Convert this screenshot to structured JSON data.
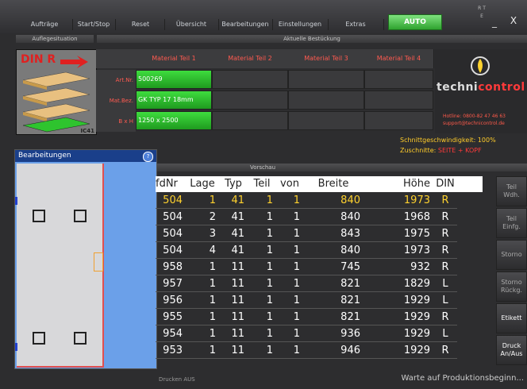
{
  "menu": {
    "items": [
      "Aufträge",
      "Start/Stop",
      "Reset",
      "Übersicht",
      "Bearbeitungen",
      "Einstellungen",
      "Extras"
    ],
    "auto_label": "AUTO",
    "rte_label": "R T E",
    "minimize_label": "_",
    "close_label": "X"
  },
  "headers": {
    "aufl": "Auflegesituation",
    "bestueckung": "Aktuelle Bestückung",
    "vorschau": "Vorschau"
  },
  "aufl": {
    "din_label": "DIN R",
    "ic_label": "IC41"
  },
  "material": {
    "columns": [
      "Material Teil 1",
      "Material Teil 2",
      "Material Teil 3",
      "Material Teil 4"
    ],
    "row_labels": [
      "Art.Nr.",
      "Mat.Bez.",
      "B x H"
    ],
    "teil1": [
      "500269",
      "GK TYP 17 18mm",
      "1250 x 2500"
    ]
  },
  "logo": {
    "text_a": "techni",
    "text_b": "control",
    "hotline_1": "Hotline: 0800-82 47 46 63",
    "hotline_2": "support@technicontrol.de"
  },
  "info": {
    "cut_speed": "Schnittgeschwindigkeit: 100%",
    "cuts_label": "Zuschnitte:",
    "cuts_value": "SEITE + KOPF"
  },
  "bearb": {
    "title": "Bearbeitungen",
    "help": "?"
  },
  "table": {
    "headers": [
      "fdNr",
      "Lage",
      "Typ",
      "Teil",
      "von",
      "Breite",
      "Höhe",
      "DIN"
    ],
    "rows": [
      [
        "504",
        "1",
        "41",
        "1",
        "1",
        "840",
        "1973",
        "R"
      ],
      [
        "504",
        "2",
        "41",
        "1",
        "1",
        "840",
        "1968",
        "R"
      ],
      [
        "504",
        "3",
        "41",
        "1",
        "1",
        "843",
        "1975",
        "R"
      ],
      [
        "504",
        "4",
        "41",
        "1",
        "1",
        "840",
        "1973",
        "R"
      ],
      [
        "958",
        "1",
        "11",
        "1",
        "1",
        "745",
        "932",
        "R"
      ],
      [
        "957",
        "1",
        "11",
        "1",
        "1",
        "821",
        "1829",
        "L"
      ],
      [
        "956",
        "1",
        "11",
        "1",
        "1",
        "821",
        "1929",
        "L"
      ],
      [
        "955",
        "1",
        "11",
        "1",
        "1",
        "821",
        "1929",
        "R"
      ],
      [
        "954",
        "1",
        "11",
        "1",
        "1",
        "936",
        "1929",
        "L"
      ],
      [
        "953",
        "1",
        "11",
        "1",
        "1",
        "946",
        "1929",
        "R"
      ]
    ]
  },
  "side_buttons": [
    {
      "line1": "Teil",
      "line2": "Wdh."
    },
    {
      "line1": "Teil",
      "line2": "Einfg."
    },
    {
      "line1": "Storno",
      "line2": ""
    },
    {
      "line1": "Storno",
      "line2": "Rückg."
    },
    {
      "line1": "Etikett",
      "line2": ""
    },
    {
      "line1": "Druck",
      "line2": "An/Aus"
    }
  ],
  "status": {
    "drucken": "Drucken AUS",
    "waiting": "Warte auf Produktionsbeginn..."
  }
}
